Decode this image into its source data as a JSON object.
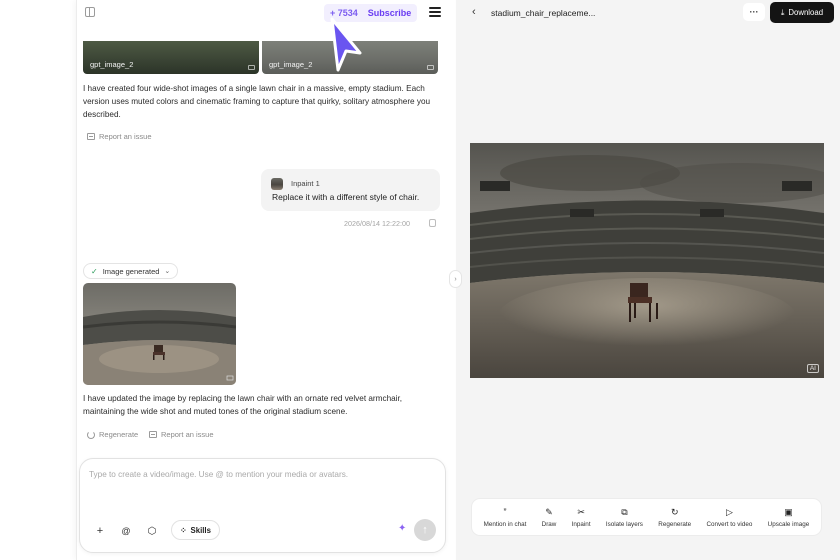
{
  "chat": {
    "credits": "+ 7534",
    "subscribe": "Subscribe",
    "thumbs": [
      {
        "label": "gpt_image_2"
      },
      {
        "label": "gpt_image_2"
      }
    ],
    "message1": "I have created four wide-shot images of a single lawn chair in a massive, empty stadium. Each version uses muted colors and cinematic framing to capture that quirky, solitary atmosphere you described.",
    "report1": "Report an issue",
    "user_ref": "Inpaint 1",
    "user_text": "Replace it with a different style of chair.",
    "timestamp": "2026/08/14 12:22:00",
    "generated_label": "Image generated",
    "message2": "I have updated the image by replacing the lawn chair with an ornate red velvet armchair, maintaining the wide shot and muted tones of the original stadium scene.",
    "regenerate": "Regenerate",
    "report2": "Report an issue",
    "placeholder": "Type to create a video/image. Use @ to mention your media or avatars.",
    "skills": "Skills"
  },
  "viewer": {
    "title": "stadium_chair_replaceme...",
    "download": "Download",
    "ai_badge": "AI",
    "tools": [
      {
        "label": "Mention in chat",
        "icon": "quote-icon"
      },
      {
        "label": "Draw",
        "icon": "brush-icon"
      },
      {
        "label": "Inpaint",
        "icon": "scissors-icon"
      },
      {
        "label": "Isolate layers",
        "icon": "layers-icon"
      },
      {
        "label": "Regenerate",
        "icon": "refresh-icon"
      },
      {
        "label": "Convert to video",
        "icon": "play-icon"
      },
      {
        "label": "Upscale image",
        "icon": "hd-icon"
      }
    ]
  },
  "colors": {
    "accent": "#7b5cf0",
    "cursor": "#6a55f0",
    "download_bg": "#141414"
  }
}
